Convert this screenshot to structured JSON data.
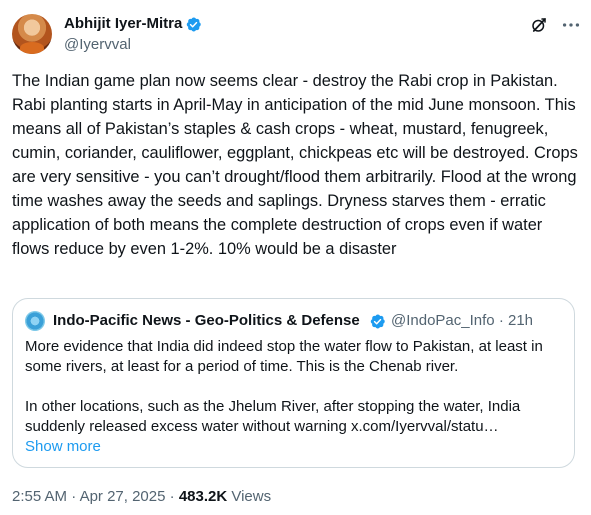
{
  "author": {
    "name": "Abhijit Iyer-Mitra",
    "handle": "@Iyervval"
  },
  "tweet": {
    "text": "The Indian game plan now seems clear - destroy the Rabi crop in Pakistan. Rabi planting starts in April-May in anticipation of the mid June monsoon. This means all of Pakistan’s staples & cash crops - wheat, mustard, fenugreek, cumin, coriander, cauliflower, eggplant, chickpeas etc will be destroyed. Crops are very sensitive - you can’t drought/flood them arbitrarily. Flood at the wrong time washes away the seeds and saplings. Dryness starves them - erratic application of both means the complete destruction of crops even if water flows reduce by even 1-2%. 10% would be a disaster"
  },
  "quote": {
    "name": "Indo-Pacific News - Geo-Politics & Defense",
    "handle": "@IndoPac_Info",
    "separator": "·",
    "time": "21h",
    "paragraph1": "More evidence that India did indeed stop the water flow to Pakistan, at least in some rivers, at least for a period of time. This is the Chenab river.",
    "paragraph2": "In other locations, such as the Jhelum River, after stopping the water, India suddenly released excess water without warning x.com/Iyervval/statu…",
    "show_more": "Show more"
  },
  "footer": {
    "time": "2:55 AM",
    "dot1": " · ",
    "date": "Apr 27, 2025",
    "dot2": " · ",
    "views_count": "483.2K",
    "views_label": " Views"
  },
  "icons": {
    "verified": "verified-badge-icon",
    "grok": "grok-icon",
    "more": "more-horizontal-icon"
  },
  "colors": {
    "text": "#0f1419",
    "secondary": "#536471",
    "accent": "#1d9bf0",
    "border": "#cfd9de"
  }
}
